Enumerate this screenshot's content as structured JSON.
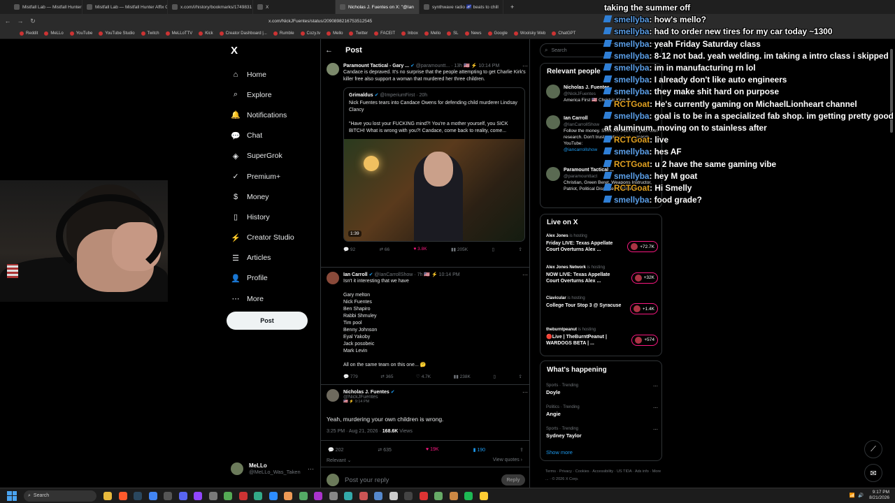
{
  "browser": {
    "tabs": [
      {
        "label": "Mistfall Lab — Mistfall Hunter Affix C",
        "active": false
      },
      {
        "label": "Mistfall Lab — Mistfall Hunter Affix C",
        "active": false
      },
      {
        "label": "x.com/i/history/bookmarks/1749831",
        "active": false
      },
      {
        "label": "X",
        "active": false
      },
      {
        "label": "Nicholas J. Fuentes on X: \"@Ian",
        "active": true
      },
      {
        "label": "synthwave radio 🌌 beats to chill",
        "active": false
      }
    ],
    "new_tab_glyph": "+",
    "url": "x.com/NickJFuentes/status/2090898216753512545",
    "bookmarks": [
      "Reddit",
      "MeLLo",
      "YouTube",
      "YouTube Studio",
      "Twitch",
      "MeLLoTTV",
      "Kick",
      "Creator Dashboard |...",
      "Rumble",
      "Cozy.tv",
      "Mello",
      "Twitter",
      "FACEIT",
      "Inbox",
      "Mello",
      "SL",
      "News",
      "Google",
      "Woolsky Web",
      "ChatGPT"
    ]
  },
  "x_nav": {
    "logo": "X",
    "items": [
      {
        "label": "Home",
        "icon": "home-icon",
        "glyph": "⌂"
      },
      {
        "label": "Explore",
        "icon": "search-icon",
        "glyph": "⌕"
      },
      {
        "label": "Notifications",
        "icon": "bell-icon",
        "glyph": "🔔"
      },
      {
        "label": "Chat",
        "icon": "chat-bubble-icon",
        "glyph": "💬"
      },
      {
        "label": "SuperGrok",
        "icon": "grok-icon",
        "glyph": "◈"
      },
      {
        "label": "Premium+",
        "icon": "premium-check-icon",
        "glyph": "✓"
      },
      {
        "label": "Money",
        "icon": "money-icon",
        "glyph": "$"
      },
      {
        "label": "History",
        "icon": "bookmark-icon",
        "glyph": "▯"
      },
      {
        "label": "Creator Studio",
        "icon": "creator-studio-icon",
        "glyph": "⚡"
      },
      {
        "label": "Articles",
        "icon": "articles-icon",
        "glyph": "☰"
      },
      {
        "label": "Profile",
        "icon": "profile-icon",
        "glyph": "👤"
      },
      {
        "label": "More",
        "icon": "more-circle-icon",
        "glyph": "⋯"
      }
    ],
    "post_button": "Post",
    "profile": {
      "name": "MeLLo",
      "handle": "@MeLLo_Was_Taken"
    }
  },
  "main": {
    "header": "Post",
    "thread": [
      {
        "name": "Paramount Tactical - Gary ...",
        "handle": "@paramountt... · 13h 🇺🇸 ⚡ 10:14 PM",
        "text": "Candace is depraved. It's no surprise that the people attempting to get Charlie Kirk's killer free also support a woman that murdered her three children.",
        "quote": {
          "name": "Grimaldus",
          "handle": "@ImperiumFirst · 20h",
          "text": "Nick Fuentes tears into Candace Owens for defending child murderer Lindsay Clancy\n\n\"Have you lost your FUCKING mind?! You're a mother yourself, you SICK BITCH! What is wrong with you?! Candace, come back to reality, come...",
          "video_duration": "1:39"
        },
        "actions": {
          "replies": "92",
          "reposts": "66",
          "likes": "3.8K",
          "views": "205K"
        }
      },
      {
        "name": "Ian Carroll",
        "handle": "@IanCarrollShow · 7h 🇺🇸 ⚡ 10:14 PM",
        "text": "Isn't it interesting that we have\n\nGary melton\nNick Fuentes\nBen Shapiro\nRabbi Shmuley\nTim pool\nBenny Johnson\nEyal Yakoby\nJack posobeic\nMark Levin\n\nAll on the same team on this one... 🤔",
        "actions": {
          "replies": "779",
          "reposts": "365",
          "likes": "4.7K",
          "views": "238K"
        }
      }
    ],
    "focus": {
      "name": "Nicholas J. Fuentes",
      "handle": "@NickJFuentes",
      "sub": "🇺🇸 ⚡ 9:14 PM",
      "text": "Yeah, murdering your own children is wrong.",
      "time": "3:25 PM · Aug 21, 2026 · ",
      "views": "168.6K",
      "views_label": " Views",
      "actions": {
        "replies": "202",
        "reposts": "635",
        "likes": "19K",
        "bookmarks": "190"
      },
      "relevant": "Relevant ⌄",
      "view_quotes": "View quotes ›"
    },
    "reply_placeholder": "Post your reply",
    "reply_button": "Reply"
  },
  "sidebar": {
    "search_placeholder": "Search",
    "relevant_title": "Relevant people",
    "people": [
      {
        "name": "Nicholas J. Fuentes",
        "handle": "@NickJFuentes",
        "bio": "America First 🇺🇸 Christ is King ✝",
        "link": ""
      },
      {
        "name": "Ian Carroll",
        "handle": "@IanCarrollShow",
        "bio": "Follow the money. Seek the truth. Do your own research. Don't trust anything but sarcasm. YouTube:",
        "link": "@iancarrollshow"
      },
      {
        "name": "Paramount Tactical ...",
        "handle": "@paramounttact",
        "bio": "Christian, Green Beret, Weapons Instructor, Patriot, Political Dissenter, Capitalist",
        "link": ""
      }
    ],
    "live_title": "Live on X",
    "live": [
      {
        "host": "Alex Jones",
        "status": "is hosting",
        "title": "Friday LIVE: Texas Appellate Court Overturns Alex ...",
        "count": "+72.7K"
      },
      {
        "host": "Alex Jones Network",
        "status": "is hosting",
        "title": "NOW LIVE: Texas Appellate Court Overturns Alex ...",
        "count": "+32K"
      },
      {
        "host": "Clavicular",
        "status": "is hosting",
        "title": "College Tour Stop 3 @ Syracuse",
        "count": "+1.4K"
      },
      {
        "host": "theburntpeanut",
        "status": "is hosting",
        "title": "🔴Live | TheBurntPeanut | WARDOGS BETA | ...",
        "count": "+574"
      }
    ],
    "happening_title": "What's happening",
    "trends": [
      {
        "category": "Sports · Trending",
        "name": "Doyle"
      },
      {
        "category": "Politics · Trending",
        "name": "Angie"
      },
      {
        "category": "Sports · Trending",
        "name": "Sydney Taylor"
      }
    ],
    "show_more": "Show more",
    "footer": "Terms · Privacy · Cookies · Accessibility · US TIDA · Ads info · More ... · © 2026 X Corp."
  },
  "chat": [
    {
      "user": "",
      "msg": "taking the summer off",
      "gold": false
    },
    {
      "user": "smellyba",
      "msg": "how's mello?",
      "gold": false
    },
    {
      "user": "smellyba",
      "msg": "had to order new tires for my car today ~1300",
      "gold": false
    },
    {
      "user": "smellyba",
      "msg": "yeah Friday Saturday class",
      "gold": false
    },
    {
      "user": "smellyba",
      "msg": "8-12 not bad. yeah welding. im taking a intro class i skipped",
      "gold": false
    },
    {
      "user": "smellyba",
      "msg": "im in manufacturing rn lol",
      "gold": false
    },
    {
      "user": "smellyba",
      "msg": "I already don't like auto engineers",
      "gold": false
    },
    {
      "user": "smellyba",
      "msg": "they make shit hard on purpose",
      "gold": false
    },
    {
      "user": "RCTGoat",
      "msg": "He's currently gaming on MichaelLionheart channel",
      "gold": true
    },
    {
      "user": "smellyba",
      "msg": "goal is to be in a specialized fab shop. im getting pretty good at aluminum. moving on to stainless after",
      "gold": false
    },
    {
      "user": "RCTGoat",
      "msg": "live",
      "gold": true
    },
    {
      "user": "smellyba",
      "msg": "hes AF",
      "gold": false
    },
    {
      "user": "RCTGoat",
      "msg": "u 2 have the same gaming vibe",
      "gold": true
    },
    {
      "user": "smellyba",
      "msg": "hey M goat",
      "gold": false
    },
    {
      "user": "RCTGoat",
      "msg": "Hi Smelly",
      "gold": true
    },
    {
      "user": "smellyba",
      "msg": "food grade?",
      "gold": false
    }
  ],
  "taskbar": {
    "search": "Search",
    "time": "9:17 PM",
    "date": "8/21/2026"
  }
}
